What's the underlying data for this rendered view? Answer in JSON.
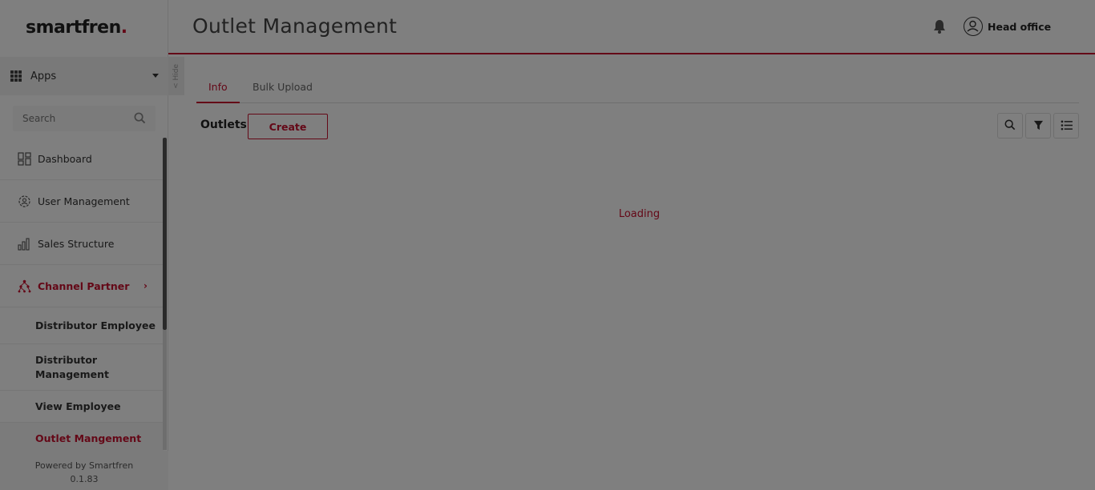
{
  "brand": {
    "name": "smartfren",
    "dot": "."
  },
  "header": {
    "title": "Outlet Management",
    "user_label": "Head office",
    "icons": {
      "bell": "bell-icon",
      "user": "user-circle-icon"
    }
  },
  "sidebar": {
    "apps_label": "Apps",
    "hide_label": "< Hide",
    "search": {
      "placeholder": "Search"
    },
    "items": [
      {
        "label": "Dashboard",
        "icon": "dashboard-icon"
      },
      {
        "label": "User Management",
        "icon": "user-gear-icon"
      },
      {
        "label": "Sales Structure",
        "icon": "bar-chart-icon"
      },
      {
        "label": "Channel Partner",
        "icon": "network-icon",
        "active": true,
        "chevron": "›"
      }
    ],
    "sub_items": [
      {
        "label": "Distributor Employee"
      },
      {
        "label": "Distributor Management"
      },
      {
        "label": "View Employee"
      },
      {
        "label": "Outlet Mangement",
        "active": true
      }
    ],
    "footer": {
      "line1": "Powered by Smartfren",
      "line2": "0.1.83"
    }
  },
  "main": {
    "tabs": [
      {
        "label": "Info",
        "active": true
      },
      {
        "label": "Bulk Upload",
        "active": false
      }
    ],
    "section_label": "Outlets",
    "create_label": "Create",
    "toolbar": [
      "search-icon",
      "filter-icon",
      "list-icon"
    ],
    "loading_text": "Loading"
  },
  "colors": {
    "accent": "#c8102e",
    "overlay": "rgba(0,0,0,0.5)"
  }
}
